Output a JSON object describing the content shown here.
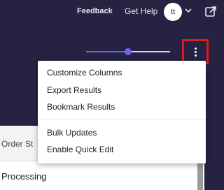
{
  "topbar": {
    "feedback_label": "Feedback",
    "help_label": "Get Help",
    "avatar_initials": "tt",
    "caret_icon": "chevron-down-icon",
    "external_icon": "external-link-icon"
  },
  "density_slider": {
    "value_fraction": 0.5
  },
  "kebab_button": {
    "icon": "more-vertical-icon",
    "highlight_color": "#e4191f"
  },
  "menu": {
    "items": [
      {
        "label": "Customize Columns"
      },
      {
        "label": "Export Results"
      },
      {
        "label": "Bookmark Results"
      },
      {
        "label": "Bulk Updates"
      },
      {
        "label": "Enable Quick Edit"
      }
    ]
  },
  "table": {
    "header": "Order St",
    "rows": [
      {
        "status": "Processing"
      }
    ]
  },
  "colors": {
    "background": "#262242",
    "accent": "#6d63f0"
  }
}
